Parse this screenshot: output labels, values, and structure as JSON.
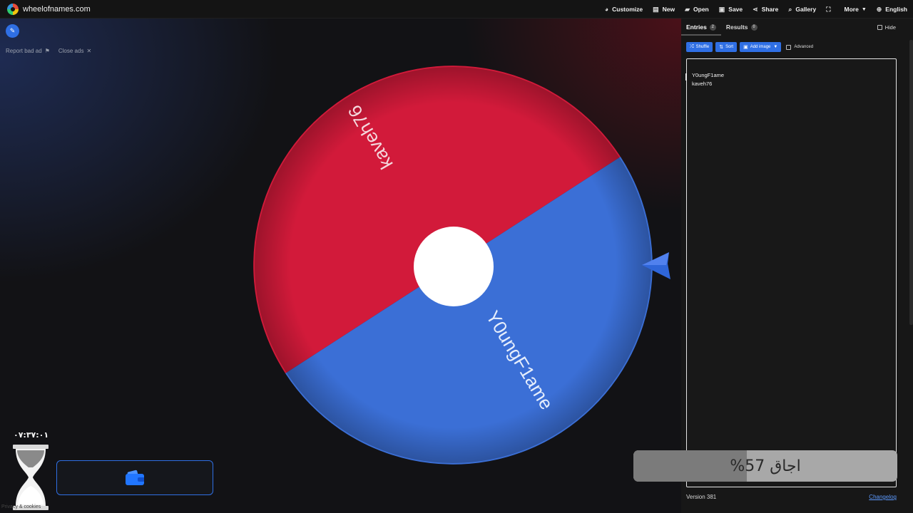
{
  "site": {
    "title": "wheelofnames.com"
  },
  "nav": {
    "items": [
      {
        "label": "Customize",
        "icon": "palette-icon",
        "glyph": "◕"
      },
      {
        "label": "New",
        "icon": "new-file-icon",
        "glyph": "▤"
      },
      {
        "label": "Open",
        "icon": "folder-icon",
        "glyph": "▰"
      },
      {
        "label": "Save",
        "icon": "save-icon",
        "glyph": "▣"
      },
      {
        "label": "Share",
        "icon": "share-icon",
        "glyph": "⋖"
      },
      {
        "label": "Gallery",
        "icon": "search-icon",
        "glyph": "⌕"
      },
      {
        "label": "",
        "icon": "fullscreen-icon",
        "glyph": "⛶"
      },
      {
        "label": "More",
        "icon": "",
        "glyph": ""
      },
      {
        "label": "English",
        "icon": "globe-icon",
        "glyph": "⊕"
      }
    ]
  },
  "ads": {
    "report": "Report bad ad",
    "close": "Close ads"
  },
  "wheel": {
    "segments": [
      {
        "label": "kaveh76",
        "color": "#d21a3a"
      },
      {
        "label": "Y0ungF1ame",
        "color": "#3b6fd6"
      }
    ],
    "center_color": "#ffffff",
    "pointer_color": "#2f66d9"
  },
  "widget": {
    "timer": "۰۷:۳۷:۰۱"
  },
  "panel": {
    "tabs": [
      {
        "label": "Entries",
        "count": "2"
      },
      {
        "label": "Results",
        "count": "0"
      }
    ],
    "hide_label": "Hide",
    "toolbar": {
      "shuffle": "Shuffle",
      "sort": "Sort",
      "add_image": "Add image",
      "advanced": "Advanced"
    },
    "entries": [
      "Y0ungF1ame",
      "kaveh76"
    ],
    "version": "Version 381",
    "changelog": "Changelog"
  },
  "progress": {
    "text": "اجاق 57%",
    "value": 0.57
  },
  "footer": {
    "privacy": "Privacy & cookies"
  }
}
